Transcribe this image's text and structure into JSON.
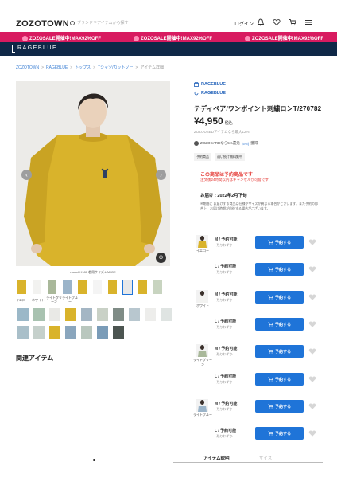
{
  "header": {
    "logo": "ZOZOTOWN",
    "search_placeholder": "ブランドやアイテムから探す",
    "login": "ログイン"
  },
  "sale_banner": {
    "items": [
      "ZOZOSALE開催中!MAX92%OFF",
      "ZOZOSALE開催中!MAX92%OFF",
      "ZOZOSALE開催中!MAX92%OFF"
    ]
  },
  "shop": {
    "name": "RAGEBLUE"
  },
  "breadcrumb": [
    "ZOZOTOWN",
    "RAGEBLUE",
    "トップス",
    "Tシャツ/カットソー",
    "アイテム詳細"
  ],
  "gallery": {
    "caption": "model H180 着用サイズ:LARGE",
    "thumb_labels": [
      "イエロー",
      "ホワイト",
      "ライトグリーン",
      "ライトブルー"
    ]
  },
  "related": {
    "title": "関連アイテム"
  },
  "product": {
    "brand1": "RAGEBLUE",
    "brand2": "RAGEBLUE",
    "title": "テディベア/ワンポイント刺繍ロンT/270782",
    "price": "¥4,950",
    "price_suffix": "税込",
    "points": "ZOZOUSEDアイテムなら最大12%",
    "card": "ZOZOCARDなら5%還元",
    "card_pct": "(5%)",
    "card_tail": "獲得",
    "tags": [
      "予約商品",
      "通い続け無料集中"
    ],
    "warning_title": "この商品は予約商品です",
    "warning_sub": "注文後24時間以内はキャンセルが可能です",
    "delivery": "お届け : 2022年2月下旬",
    "note": "※期間に お届けする商品は仕様やサイズが異なる場合がございます。また予約の都合上、お届け時期が前後する場合がございます。"
  },
  "variants": [
    {
      "color": "イエロー",
      "size": "M / 予約可能",
      "stock": "残りわずか"
    },
    {
      "color": "",
      "size": "L / 予約可能",
      "stock": "残りわずか"
    },
    {
      "color": "ホワイト",
      "size": "M / 予約可能",
      "stock": "残りわずか"
    },
    {
      "color": "",
      "size": "L / 予約可能",
      "stock": "残りわずか"
    },
    {
      "color": "ライトグリーン",
      "size": "M / 予約可能",
      "stock": "残りわずか"
    },
    {
      "color": "",
      "size": "L / 予約可能",
      "stock": "残りわずか"
    },
    {
      "color": "ライトブルー",
      "size": "M / 予約可能",
      "stock": "残りわずか"
    },
    {
      "color": "",
      "size": "L / 予約可能",
      "stock": "残りわずか"
    }
  ],
  "reserve_label": "予約する",
  "tabs": [
    "アイテム説明",
    "サイズ"
  ],
  "colors": {
    "accent": "#1f74d8",
    "sale": "#d81b60",
    "shopbar": "#0f2847",
    "warning": "#e53935",
    "mustard": "#d9b32b"
  }
}
